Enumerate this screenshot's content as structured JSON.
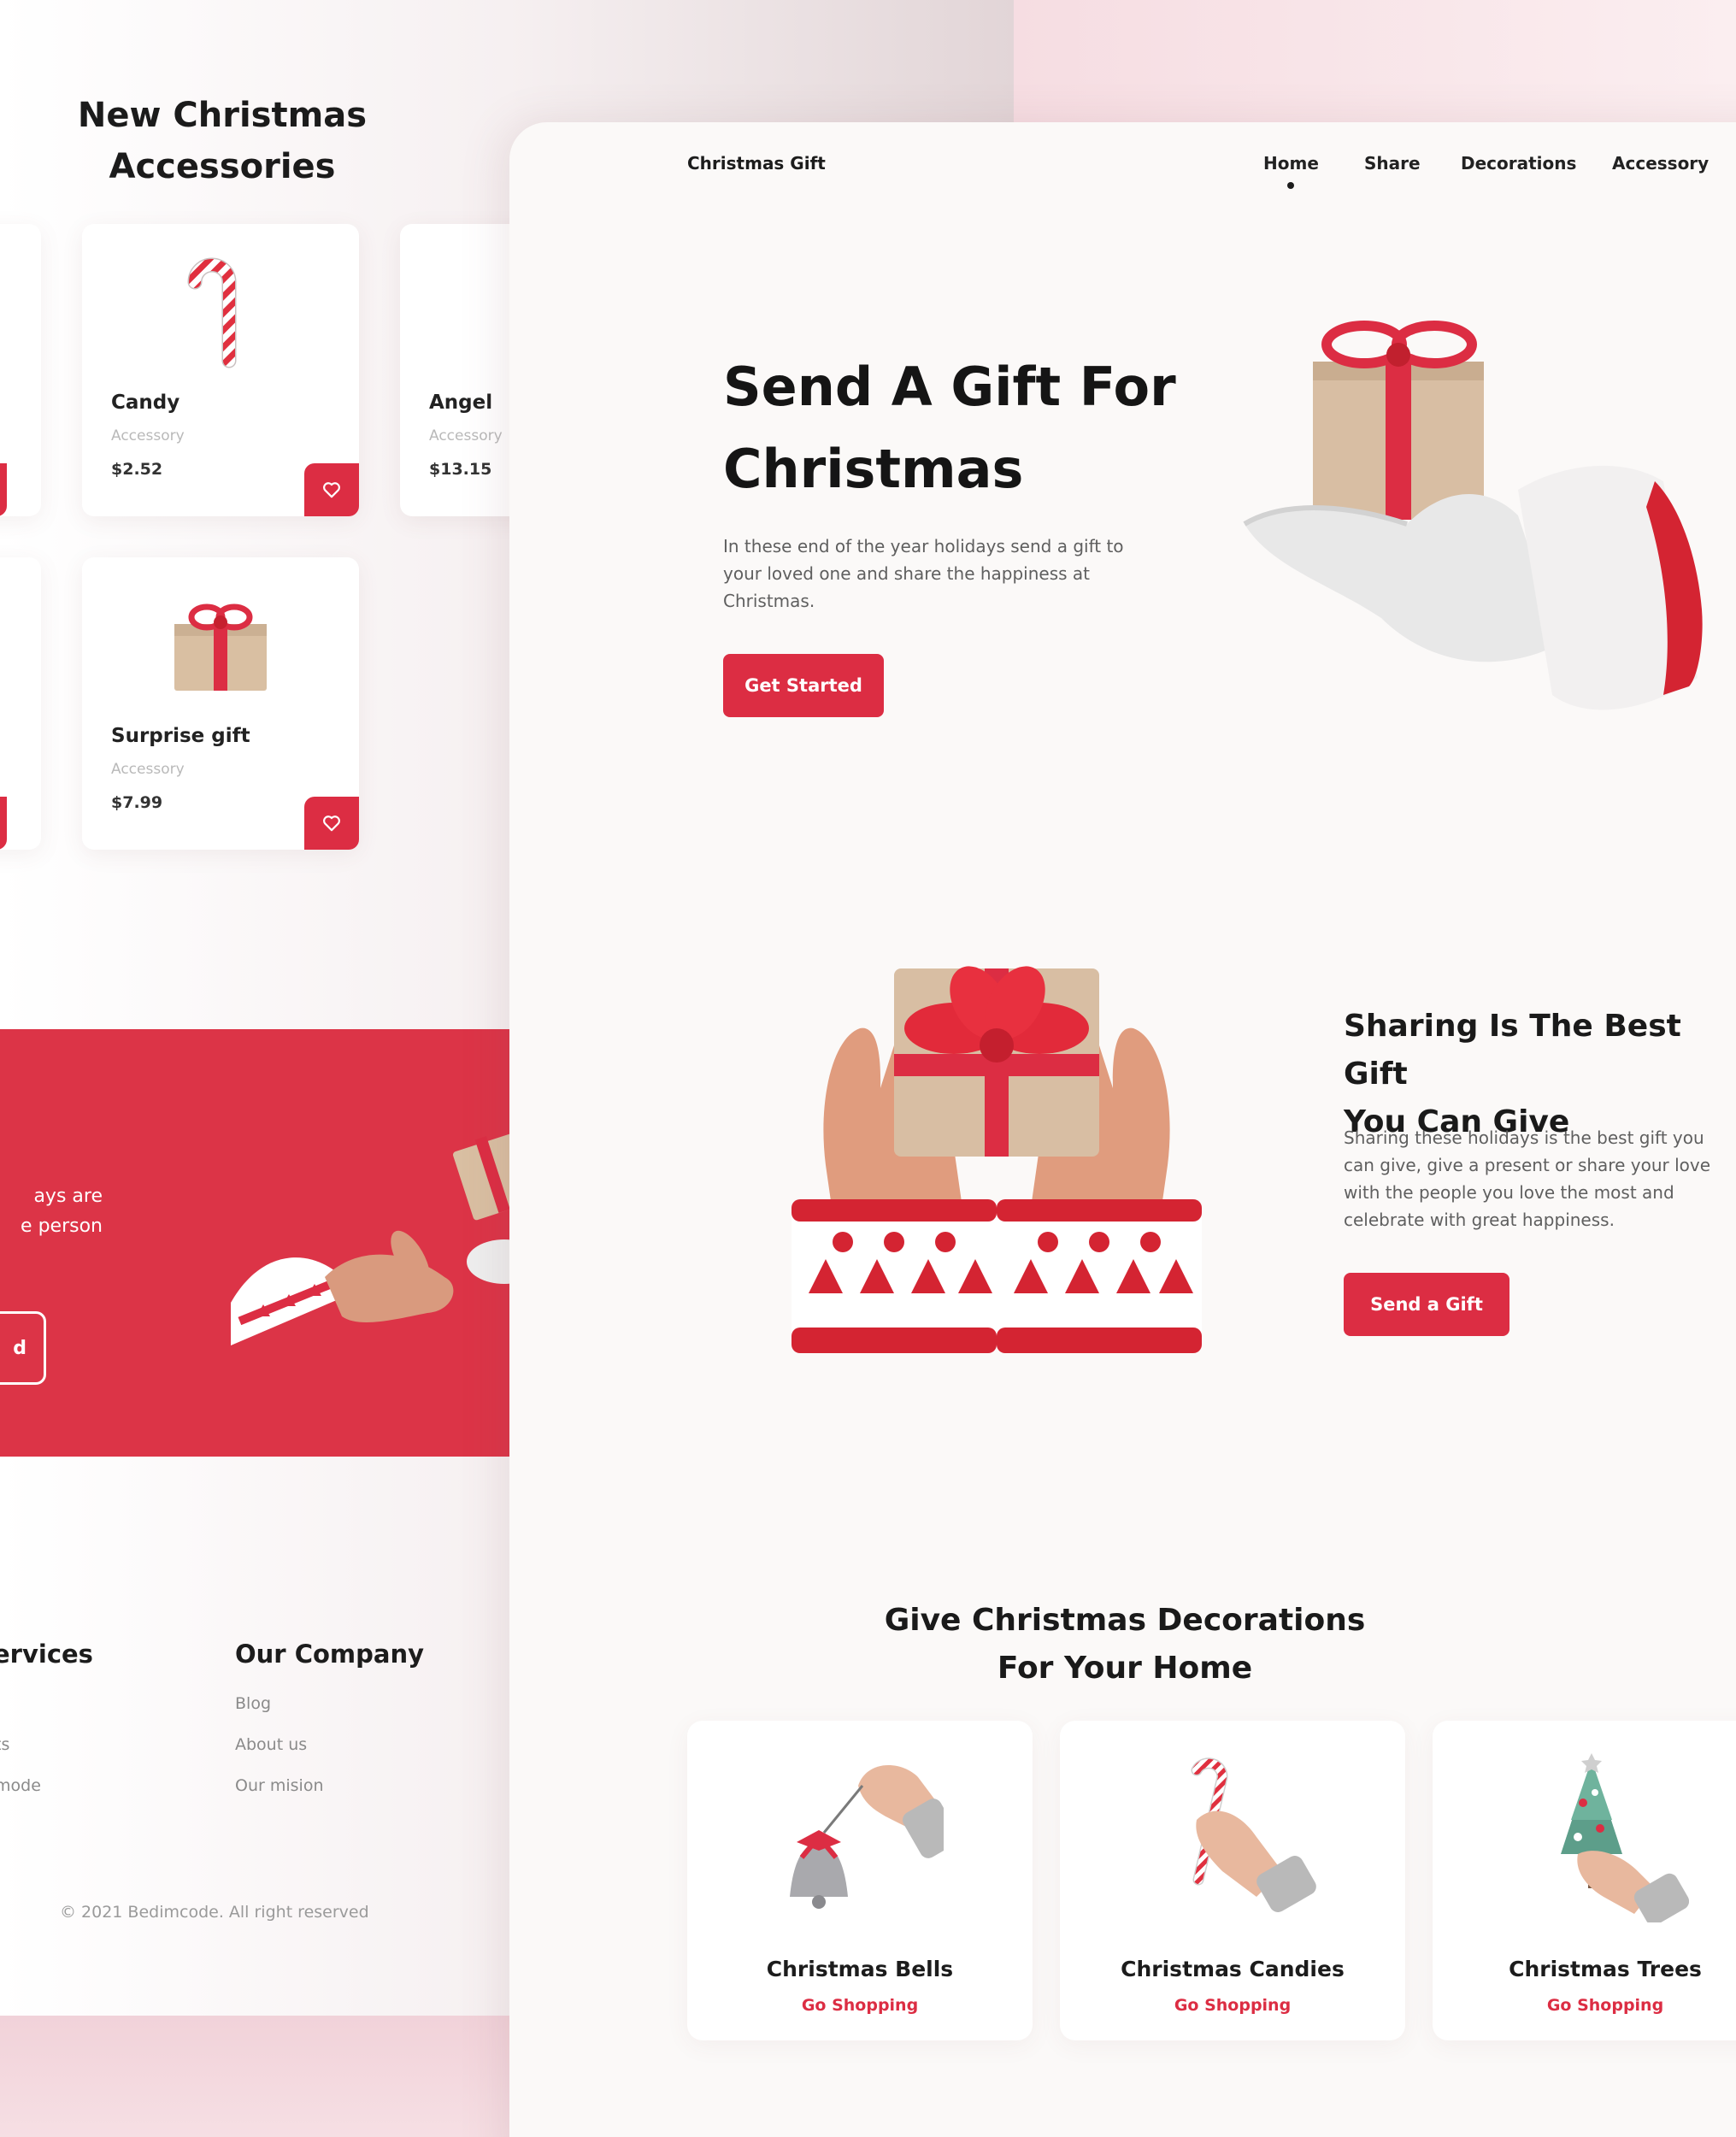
{
  "colors": {
    "accent": "#dc2d43",
    "page": "#fbf9f8",
    "heading": "#1a1a1a",
    "muted": "#8a8a8a"
  },
  "back_page": {
    "accessories_title": "New Christmas Accessories",
    "products": [
      {
        "name": "Candy",
        "category": "Accessory",
        "price": "$2.52",
        "image": "candy-cane-icon"
      },
      {
        "name": "Angel",
        "category": "Accessory",
        "price": "$13.15",
        "image": "angel-icon"
      },
      {
        "name": "Surprise gift",
        "category": "Accessory",
        "price": "$7.99",
        "image": "gift-box-icon"
      }
    ],
    "promo": {
      "text_line1": "ays are",
      "text_line2": "e person",
      "button_fragment": "d"
    },
    "footer": {
      "services_heading": "ervices",
      "services_links": [
        "ts",
        "mode"
      ],
      "company_heading": "Our Company",
      "company_links": [
        "Blog",
        "About us",
        "Our mision"
      ],
      "copyright": "© 2021 Bedimcode. All right reserved"
    }
  },
  "front_page": {
    "logo": "Christmas Gift",
    "nav": [
      "Home",
      "Share",
      "Decorations",
      "Accessory"
    ],
    "nav_active": "Home",
    "hero": {
      "title_line1": "Send A Gift For",
      "title_line2": "Christmas",
      "text": "In these end of the year holidays send a gift to your loved one and share the happiness at Christmas.",
      "button": "Get Started"
    },
    "share": {
      "title_line1": "Sharing Is The Best Gift",
      "title_line2": "You Can Give",
      "text": "Sharing these holidays is the best gift you can give, give a present or share your love with the people you love the most and celebrate with great happiness.",
      "button": "Send a Gift"
    },
    "decorations": {
      "title_line1": "Give Christmas Decorations",
      "title_line2": "For Your Home",
      "items": [
        {
          "name": "Christmas Bells",
          "link": "Go Shopping",
          "image": "bell-in-hand-icon"
        },
        {
          "name": "Christmas Candies",
          "link": "Go Shopping",
          "image": "candy-cane-in-hand-icon"
        },
        {
          "name": "Christmas Trees",
          "link": "Go Shopping",
          "image": "tree-in-hand-icon"
        }
      ]
    }
  }
}
